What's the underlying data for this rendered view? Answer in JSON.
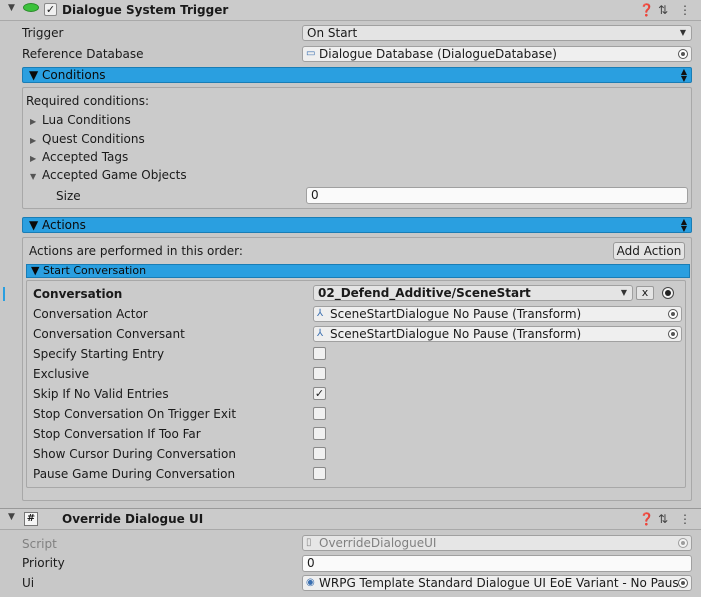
{
  "component1": {
    "title": "Dialogue System Trigger",
    "enabled_mark": "✓",
    "icons": [
      "help-icon",
      "settings-icon",
      "more-icon"
    ]
  },
  "trigger": {
    "label": "Trigger",
    "value": "On Start"
  },
  "reference_database": {
    "label": "Reference Database",
    "value": "Dialogue Database (DialogueDatabase)"
  },
  "conditions": {
    "header": "▼ Conditions",
    "required_label": "Required conditions:",
    "items": [
      "Lua Conditions",
      "Quest Conditions",
      "Accepted Tags",
      "Accepted Game Objects"
    ],
    "size_label": "Size",
    "size_value": "0"
  },
  "actions": {
    "header": "▼ Actions",
    "order_label": "Actions are performed in this order:",
    "add_action": "Add Action",
    "start_conversation": {
      "header": "▼ Start Conversation",
      "conversation_label": "Conversation",
      "conversation_value": "02_Defend_Additive/SceneStart",
      "clear_label": "x",
      "actor_label": "Conversation Actor",
      "actor_value": "SceneStartDialogue No Pause (Transform)",
      "conversant_label": "Conversation Conversant",
      "conversant_value": "SceneStartDialogue No Pause (Transform)",
      "toggles": [
        {
          "label": "Specify Starting Entry",
          "checked": false,
          "mark": ""
        },
        {
          "label": "Exclusive",
          "checked": false,
          "mark": ""
        },
        {
          "label": "Skip If No Valid Entries",
          "checked": true,
          "mark": "✓"
        },
        {
          "label": "Stop Conversation On Trigger Exit",
          "checked": false,
          "mark": ""
        },
        {
          "label": "Stop Conversation If Too Far",
          "checked": false,
          "mark": ""
        },
        {
          "label": "Show Cursor During Conversation",
          "checked": false,
          "mark": ""
        },
        {
          "label": "Pause Game During Conversation",
          "checked": false,
          "mark": ""
        }
      ]
    }
  },
  "component2": {
    "title": "Override Dialogue UI",
    "script_icon_glyph": "#",
    "enabled_mark": "✓",
    "script_label": "Script",
    "script_value": "OverrideDialogueUI",
    "priority_label": "Priority",
    "priority_value": "0",
    "ui_label": "Ui",
    "ui_value": "WRPG Template Standard Dialogue UI EoE Variant - No Pause"
  },
  "colors": {
    "accent_blue": "#2a9fe0",
    "panel_bg": "#c8c8c8"
  }
}
